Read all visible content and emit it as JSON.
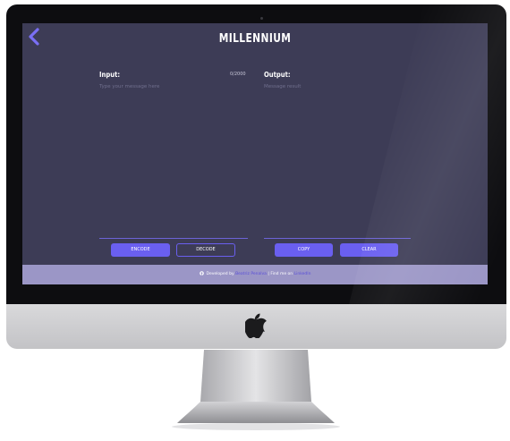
{
  "app": {
    "title": "MILLENNIUM"
  },
  "input_panel": {
    "label": "Input:",
    "placeholder": "Type your message here",
    "counter": "0/2000",
    "value": ""
  },
  "output_panel": {
    "label": "Output:",
    "placeholder": "Message result",
    "value": ""
  },
  "buttons": {
    "encode": "ENCODE",
    "decode": "DECODE",
    "copy": "COPY",
    "clear": "CLEAR"
  },
  "footer": {
    "prefix": "Developed by",
    "author": "Beatriz Penalva",
    "separator": "| Find me on",
    "link": "LinkedIn"
  },
  "icons": {
    "back": "chevron-left-icon",
    "github": "github-icon",
    "apple": "apple-logo-icon"
  },
  "colors": {
    "background": "#3d3c56",
    "accent": "#6a5ff0",
    "footer": "#9b96c6",
    "placeholder": "#706f8d"
  }
}
